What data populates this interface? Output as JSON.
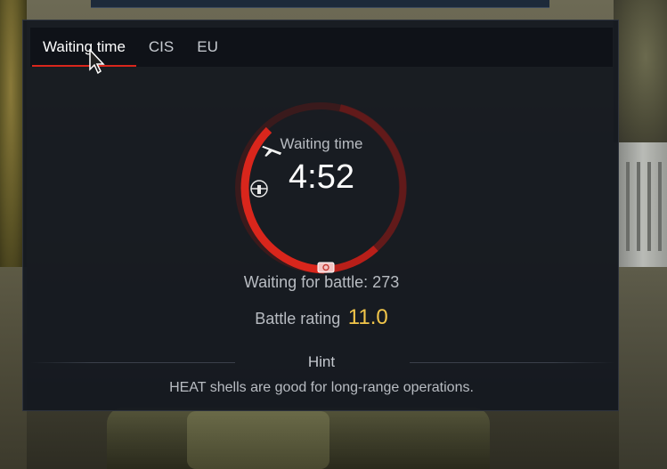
{
  "tabs": [
    {
      "label": "Waiting time",
      "active": true
    },
    {
      "label": "CIS",
      "active": false
    },
    {
      "label": "EU",
      "active": false
    }
  ],
  "queue": {
    "label": "Waiting time",
    "value": "4:52",
    "waiting_for_battle": "Waiting for battle: 273",
    "battle_rating_label": "Battle rating",
    "battle_rating_value": "11.0"
  },
  "hint": {
    "title": "Hint",
    "text": "HEAT shells are good for long-range operations."
  },
  "icons": {
    "plane": "plane-icon",
    "helicopter": "helicopter-icon",
    "tank": "tank-icon"
  },
  "colors": {
    "accent_red": "#d9261c",
    "br_yellow": "#f2c64a"
  }
}
